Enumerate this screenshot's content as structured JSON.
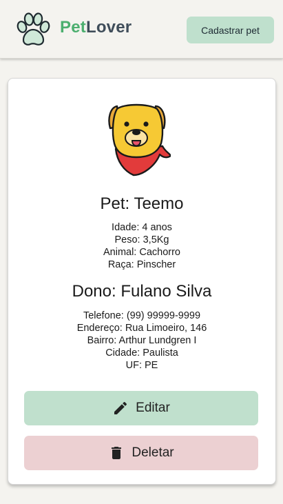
{
  "header": {
    "logo_icon": "paw-icon",
    "brand_part1": "Pet",
    "brand_part2": "Lover",
    "cadastrar_label": "Cadastrar pet",
    "colors": {
      "brand_green": "#4caf6f",
      "brand_dark": "#3f4d5a",
      "button_green": "#bfe0cd"
    }
  },
  "pet": {
    "avatar_icon": "dog-avatar-icon",
    "title": "Pet: Teemo",
    "details": [
      "Idade: 4 anos",
      "Peso: 3,5Kg",
      "Animal: Cachorro",
      "Raça: Pinscher"
    ]
  },
  "owner": {
    "title": "Dono: Fulano Silva",
    "details": [
      "Telefone: (99) 99999-9999",
      "Endereço: Rua Limoeiro, 146",
      "Bairro: Arthur Lundgren I",
      "Cidade: Paulista",
      "UF: PE"
    ]
  },
  "actions": {
    "edit_label": "Editar",
    "edit_icon": "pencil-icon",
    "delete_label": "Deletar",
    "delete_icon": "trash-icon",
    "colors": {
      "edit_bg": "#c0e0cd",
      "delete_bg": "#ecd0d2"
    }
  }
}
